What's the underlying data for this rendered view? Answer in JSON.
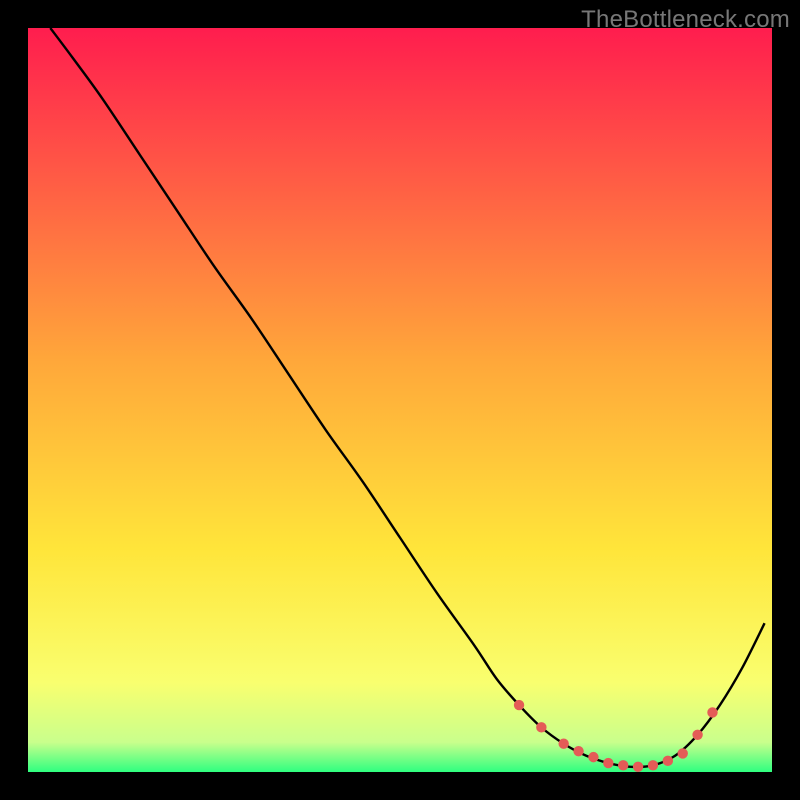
{
  "watermark": "TheBottleneck.com",
  "accent": {
    "curve": "#000000",
    "dots": "#e45c57"
  },
  "gradient": {
    "stops": [
      {
        "offset": 0.0,
        "color": "#ff1d4e"
      },
      {
        "offset": 0.45,
        "color": "#ffa83a"
      },
      {
        "offset": 0.7,
        "color": "#ffe53a"
      },
      {
        "offset": 0.88,
        "color": "#f9ff6f"
      },
      {
        "offset": 0.96,
        "color": "#c9ff8c"
      },
      {
        "offset": 1.0,
        "color": "#2fff80"
      }
    ]
  },
  "chart_data": {
    "type": "line",
    "title": "",
    "xlabel": "",
    "ylabel": "",
    "xlim": [
      0,
      100
    ],
    "ylim": [
      0,
      100
    ],
    "series": [
      {
        "name": "bottleneck-curve",
        "x": [
          3,
          6,
          10,
          15,
          20,
          25,
          30,
          35,
          40,
          45,
          50,
          55,
          60,
          63,
          66,
          69,
          72,
          75,
          78,
          81,
          84,
          87,
          90,
          93,
          96,
          99
        ],
        "y": [
          100,
          96,
          90.5,
          83,
          75.5,
          68,
          61,
          53.5,
          46,
          39,
          31.5,
          24,
          17,
          12.5,
          9,
          6,
          3.8,
          2.2,
          1.2,
          0.7,
          0.9,
          2.2,
          5,
          9,
          14,
          20
        ]
      }
    ],
    "markers": {
      "name": "optimal-range-dots",
      "x": [
        66,
        69,
        72,
        74,
        76,
        78,
        80,
        82,
        84,
        86,
        88,
        90,
        92
      ],
      "y": [
        9,
        6,
        3.8,
        2.8,
        2.0,
        1.2,
        0.9,
        0.7,
        0.9,
        1.5,
        2.5,
        5,
        8
      ]
    }
  }
}
